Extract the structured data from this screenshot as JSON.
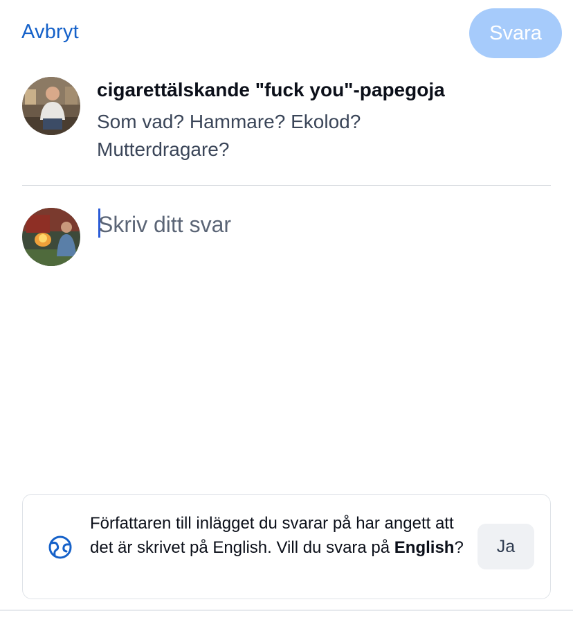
{
  "header": {
    "cancel_label": "Avbryt",
    "reply_label": "Svara"
  },
  "parent_post": {
    "author": "cigarettälskande \"fuck you\"-papegoja",
    "text": "Som vad? Hammare? Ekolod? Mutterdragare?",
    "avatar_icon": "user-avatar"
  },
  "composer": {
    "placeholder": "Skriv ditt svar",
    "value": "",
    "avatar_icon": "user-avatar"
  },
  "language_notice": {
    "icon": "language-globe-icon",
    "text_before": "Författaren till inlägget du svarar på har angett att det är skrivet på English. Vill du svara på ",
    "language": "English",
    "text_after": "?",
    "yes_label": "Ja"
  },
  "colors": {
    "accent": "#1561c9",
    "reply_button_disabled": "#a6cbfb",
    "divider": "#d0d4da",
    "caret": "#2a5bd7"
  }
}
